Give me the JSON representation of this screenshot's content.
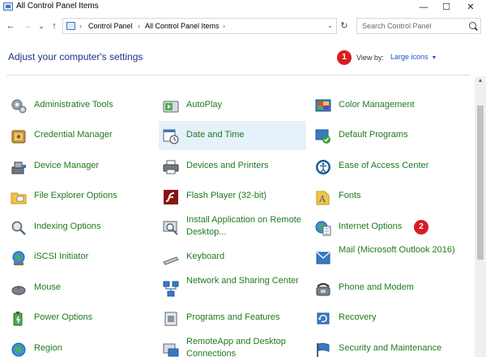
{
  "window": {
    "title": "All Control Panel Items",
    "controls": {
      "minimize": "—",
      "maximize": "☐",
      "close": "✕"
    }
  },
  "address": {
    "back_icon": "←",
    "forward_icon": "→",
    "recent_icon": "⌄",
    "up_icon": "↑",
    "crumbs": [
      "Control Panel",
      "All Control Panel Items"
    ],
    "separator": "›",
    "dropdown_icon": "⌄",
    "refresh_icon": "↻",
    "search_placeholder": "Search Control Panel"
  },
  "header": {
    "title": "Adjust your computer's settings",
    "view_by_label": "View by:",
    "view_by_value": "Large icons",
    "view_by_caret": "▼"
  },
  "badges": {
    "first": "1",
    "second": "2"
  },
  "items": [
    {
      "label": "Administrative Tools",
      "icon": "gears-icon"
    },
    {
      "label": "AutoPlay",
      "icon": "autoplay-icon"
    },
    {
      "label": "Color Management",
      "icon": "color-management-icon"
    },
    {
      "label": "Credential Manager",
      "icon": "credential-vault-icon"
    },
    {
      "label": "Date and Time",
      "icon": "calendar-clock-icon"
    },
    {
      "label": "Default Programs",
      "icon": "default-programs-icon"
    },
    {
      "label": "Device Manager",
      "icon": "device-manager-icon"
    },
    {
      "label": "Devices and Printers",
      "icon": "printer-icon"
    },
    {
      "label": "Ease of Access Center",
      "icon": "ease-of-access-icon"
    },
    {
      "label": "File Explorer Options",
      "icon": "folder-options-icon"
    },
    {
      "label": "Flash Player (32-bit)",
      "icon": "flash-player-icon"
    },
    {
      "label": "Fonts",
      "icon": "fonts-icon"
    },
    {
      "label": "Indexing Options",
      "icon": "indexing-icon"
    },
    {
      "label": "Install Application on Remote Desktop...",
      "icon": "install-remote-icon"
    },
    {
      "label": "Internet Options",
      "icon": "internet-options-icon"
    },
    {
      "label": "iSCSI Initiator",
      "icon": "iscsi-globe-icon"
    },
    {
      "label": "Keyboard",
      "icon": "keyboard-icon"
    },
    {
      "label": "Mail (Microsoft Outlook 2016)",
      "icon": "mail-icon"
    },
    {
      "label": "Mouse",
      "icon": "mouse-icon"
    },
    {
      "label": "Network and Sharing Center",
      "icon": "network-icon"
    },
    {
      "label": "Phone and Modem",
      "icon": "phone-icon"
    },
    {
      "label": "Power Options",
      "icon": "power-icon"
    },
    {
      "label": "Programs and Features",
      "icon": "programs-icon"
    },
    {
      "label": "Recovery",
      "icon": "recovery-icon"
    },
    {
      "label": "Region",
      "icon": "region-globe-icon"
    },
    {
      "label": "RemoteApp and Desktop Connections",
      "icon": "remoteapp-icon"
    },
    {
      "label": "Security and Maintenance",
      "icon": "security-flag-icon"
    }
  ],
  "colors": {
    "heading": "#1e3287",
    "link_green": "#1f7a1f",
    "badge_red": "#d81c23",
    "selection": "#e5f1fb",
    "view_by_link": "#1a55c7"
  }
}
